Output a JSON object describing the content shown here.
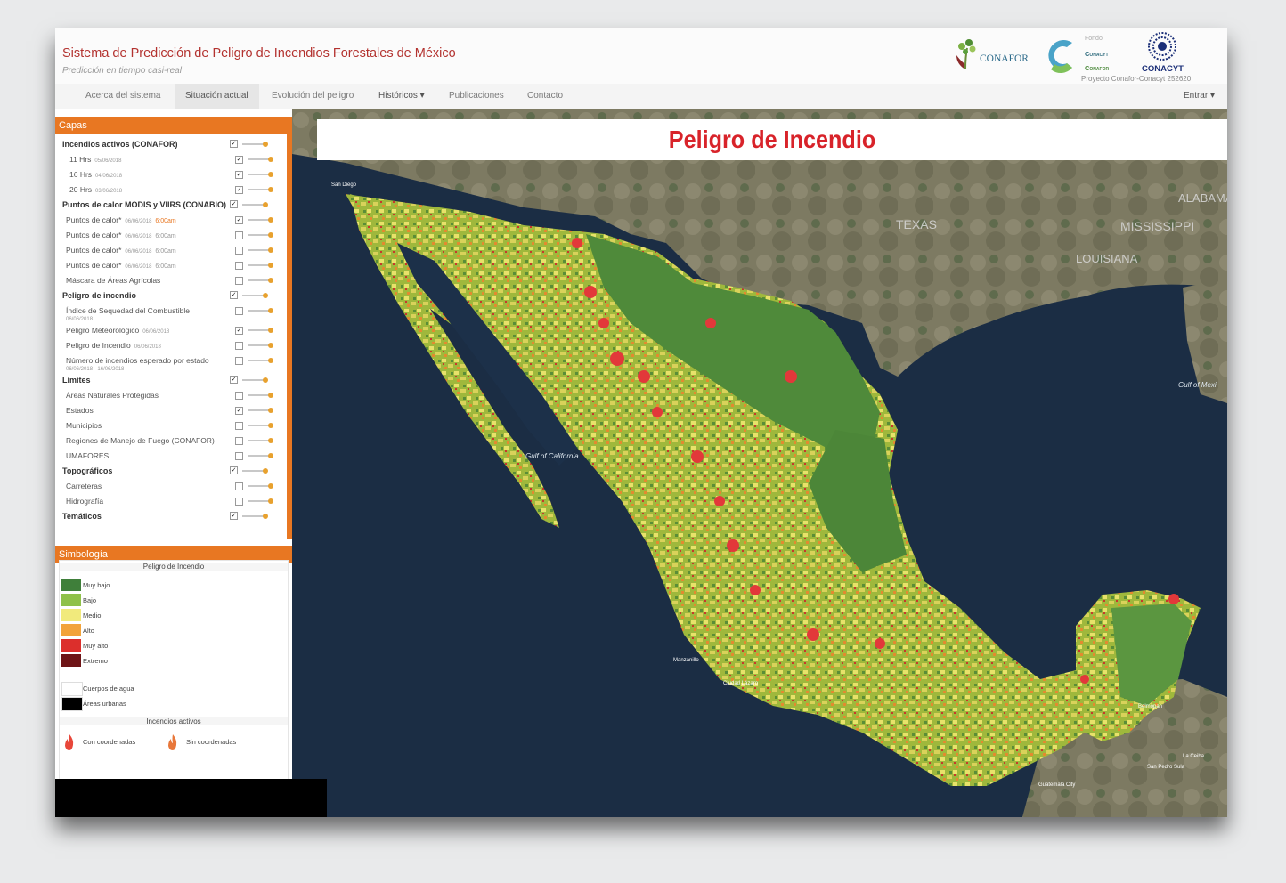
{
  "header": {
    "title": "Sistema de Predicción de Peligro de Incendios Forestales de México",
    "subtitle": "Predicción en tiempo casi-real",
    "logos": {
      "conafor": "CONAFOR",
      "fondo": "Fondo",
      "conacyt_small": "Conacyt",
      "conafor_small": "Conafor",
      "conacyt": "CONACYT",
      "project": "Proyecto Conafor-Conacyt 252620"
    }
  },
  "nav": {
    "items": [
      "Acerca del sistema",
      "Situación actual",
      "Evolución del peligro",
      "Históricos ▾",
      "Publicaciones",
      "Contacto"
    ],
    "active_index": 1,
    "login": "Entrar ▾"
  },
  "map": {
    "title": "Peligro de Incendio",
    "labels": {
      "texas": "TEXAS",
      "mississippi": "MISSISSIPPI",
      "louisiana": "LOUISIANA",
      "alabama": "ALABAMA",
      "gulf_california": "Gulf of California",
      "gulf_mexico": "Gulf of Mexi",
      "san_diego": "San Diego",
      "manzanillo": "Manzanillo",
      "ciudad_lazaro": "Ciudad Lázaro",
      "guatemala": "Guatemala City",
      "belize": "Belmopan",
      "san_pedro": "San Pedro Sula",
      "la_ceiba": "La Ceiba"
    }
  },
  "panel": {
    "layers_header": "Capas",
    "legend_header": "Simbología",
    "layers": [
      {
        "label": "Incendios activos (CONAFOR)",
        "group": true,
        "checked": true
      },
      {
        "label": "11 Hrs",
        "date": "05/06/2018",
        "indent": 2,
        "checked": true
      },
      {
        "label": "16 Hrs",
        "date": "04/06/2018",
        "indent": 2,
        "checked": true
      },
      {
        "label": "20 Hrs",
        "date": "03/06/2018",
        "indent": 2,
        "checked": true
      },
      {
        "label": "Puntos de calor MODIS y VIIRS (CONABIO)",
        "group": true,
        "checked": true
      },
      {
        "label": "Puntos de calor*",
        "date": "06/06/2018",
        "time": "6:00am",
        "hot": true,
        "indent": 1,
        "checked": true
      },
      {
        "label": "Puntos de calor*",
        "date": "06/06/2018",
        "time": "6:00am",
        "indent": 1,
        "checked": false
      },
      {
        "label": "Puntos de calor*",
        "date": "06/06/2018",
        "time": "6:00am",
        "indent": 1,
        "checked": false
      },
      {
        "label": "Puntos de calor*",
        "date": "06/06/2018",
        "time": "6:00am",
        "indent": 1,
        "checked": false
      },
      {
        "label": "Máscara de Áreas Agrícolas",
        "indent": 1,
        "checked": false
      },
      {
        "label": "Peligro de incendio",
        "group": true,
        "checked": true
      },
      {
        "label": "Índice de Sequedad del Combustible",
        "date2": "06/06/2018",
        "indent": 1,
        "checked": false
      },
      {
        "label": "Peligro Meteorológico",
        "date": "06/06/2018",
        "indent": 1,
        "checked": true
      },
      {
        "label": "Peligro de Incendio",
        "date": "06/06/2018",
        "indent": 1,
        "checked": false
      },
      {
        "label": "Número de incendios esperado por estado",
        "date2": "06/06/2018 - 16/06/2018",
        "indent": 1,
        "checked": false
      },
      {
        "label": "Límites",
        "group": true,
        "checked": true
      },
      {
        "label": "Áreas Naturales Protegidas",
        "indent": 1,
        "checked": false
      },
      {
        "label": "Estados",
        "indent": 1,
        "checked": true
      },
      {
        "label": "Municipios",
        "indent": 1,
        "checked": false
      },
      {
        "label": "Regiones de Manejo de Fuego (CONAFOR)",
        "indent": 1,
        "checked": false
      },
      {
        "label": "UMAFORES",
        "indent": 1,
        "checked": false
      },
      {
        "label": "Topográficos",
        "group": true,
        "checked": true
      },
      {
        "label": "Carreteras",
        "indent": 1,
        "checked": false
      },
      {
        "label": "Hidrografía",
        "indent": 1,
        "checked": false
      },
      {
        "label": "Temáticos",
        "group": true,
        "checked": true
      }
    ],
    "legend": {
      "heading": "Peligro de Incendio",
      "classes": [
        {
          "label": "Muy bajo",
          "color": "#3f7f3a"
        },
        {
          "label": "Bajo",
          "color": "#8fc149"
        },
        {
          "label": "Medio",
          "color": "#f1ea7c"
        },
        {
          "label": "Alto",
          "color": "#f2a33a"
        },
        {
          "label": "Muy alto",
          "color": "#dc2f2c"
        },
        {
          "label": "Extremo",
          "color": "#6e1416"
        }
      ],
      "extra": [
        {
          "label": "Cuerpos de agua",
          "color": "#ffffff"
        },
        {
          "label": "Áreas urbanas",
          "color": "#000000"
        }
      ],
      "fires_heading": "Incendios activos",
      "fires": [
        {
          "label": "Con coordenadas",
          "color": "#e8473a"
        },
        {
          "label": "Sin coordenadas",
          "color": "#e8773a"
        }
      ]
    }
  }
}
